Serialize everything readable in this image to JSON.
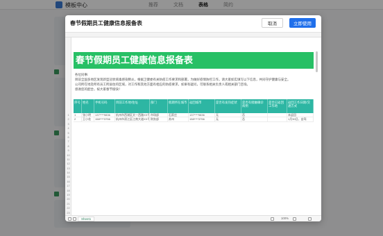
{
  "background": {
    "brand": "模板中心",
    "tabs": [
      "推荐",
      "文档",
      "表格",
      "简约"
    ],
    "active_tab": "表格"
  },
  "modal": {
    "title": "春节假期员工健康信息报备表",
    "cancel_label": "取消",
    "use_label": "立即使用"
  },
  "sheet": {
    "banner": "春节假期员工健康信息报备表",
    "notes": [
      "各位同事:",
      "目前全国多地区发现新型冠状病毒感染肺炎，根据卫健委有关防疫工作要求和部署，为做好疫情防控工作，请大家如实填写以下信息，共同守护健康与安全。",
      "公司所在地及所有员工所居住的区域，对工作和其他方面有相应的防疫要求，如果有疑问，可联系相关负责人或相关部门咨询。",
      "感谢您的配合，祝大家春节愉快！"
    ],
    "columns": [
      "序号",
      "姓名",
      "手机号码",
      "目前工作地/住址",
      "部门",
      "假期所在城市",
      "返回城市",
      "是否有发热症状",
      "是否有接触确诊病例",
      "是否已返回工作地",
      "返回工作日期/交通方式"
    ],
    "rows": [
      [
        "1",
        "张小明",
        "137****9836",
        "杭州市西湖区文一西路XX号",
        "市场部",
        "石家庄",
        "137****9836",
        "无",
        "否",
        "",
        "未返回"
      ],
      [
        "2",
        "王小花",
        "158****3756",
        "杭州市滨江区江南大道XX号",
        "财务部",
        "苏州",
        "158****3756",
        "无",
        "否",
        "",
        "1月30日，自驾"
      ]
    ],
    "row_numbers": [
      "1",
      "2",
      "3",
      "4",
      "5",
      "6",
      "7",
      "8",
      "9",
      "10",
      "11",
      "12",
      "13",
      "14",
      "15",
      "16",
      "17",
      "18",
      "19",
      "20",
      "21",
      "22",
      "23",
      "24",
      "25"
    ],
    "footer_tab": "Sheet1",
    "zoom": "100%"
  }
}
